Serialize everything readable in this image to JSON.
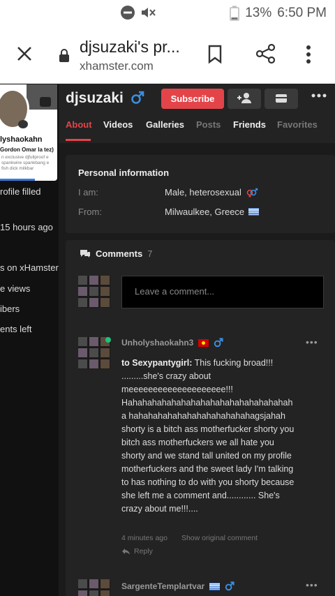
{
  "status_bar": {
    "battery": "13%",
    "time": "6:50 PM"
  },
  "browser": {
    "tab_title": "djsuzaki's pr...",
    "url": "xhamster.com"
  },
  "sidebar": {
    "username": "lyshaokahn",
    "subtitle": "Gordon Omar la tez)",
    "bio": "n exclusive djfullproof e spankwire spankbang e fish dick milkbar",
    "items": [
      {
        "label": "rofile filled"
      },
      {
        "label": "15 hours ago"
      },
      {
        "label": "s on xHamster"
      },
      {
        "label": "e views"
      },
      {
        "label": "ibers"
      },
      {
        "label": "ents left"
      }
    ]
  },
  "profile": {
    "username": "djsuzaki",
    "subscribe_label": "Subscribe",
    "tabs": [
      {
        "label": "About"
      },
      {
        "label": "Videos"
      },
      {
        "label": "Galleries"
      },
      {
        "label": "Posts"
      },
      {
        "label": "Friends"
      },
      {
        "label": "Favorites"
      }
    ]
  },
  "personal_info": {
    "title": "Personal information",
    "i_am_label": "I am:",
    "i_am_value": "Male, heterosexual",
    "from_label": "From:",
    "from_value": "Milwaulkee, Greece"
  },
  "comments": {
    "title": "Comments",
    "count": "7",
    "placeholder": "Leave a comment...",
    "items": [
      {
        "author": "Unholyshaokahn3",
        "reply_to": "to Sexypantygirl:",
        "text": "This fucking broad!!! .........she's crazy about meeeeeeeeeeeeeeeeeeee!!! Hahahahahahahahahahahahahahahahahaha hahahahahahahahahahahahahagsjahah shorty is a bitch ass motherfucker shorty you bitch ass motherfuckers we all hate you shorty and we stand tall united on my profile motherfuckers and the sweet lady I'm talking to has nothing to do with you shorty because she left me a comment and............ She's crazy about me!!!....",
        "time": "4 minutes ago",
        "show_original": "Show original comment",
        "reply": "Reply"
      },
      {
        "author": "SargenteTemplartvar"
      }
    ]
  },
  "colors": {
    "accent": "#e34449",
    "male_blue": "#3b8fe0",
    "online": "#1ec27c"
  }
}
